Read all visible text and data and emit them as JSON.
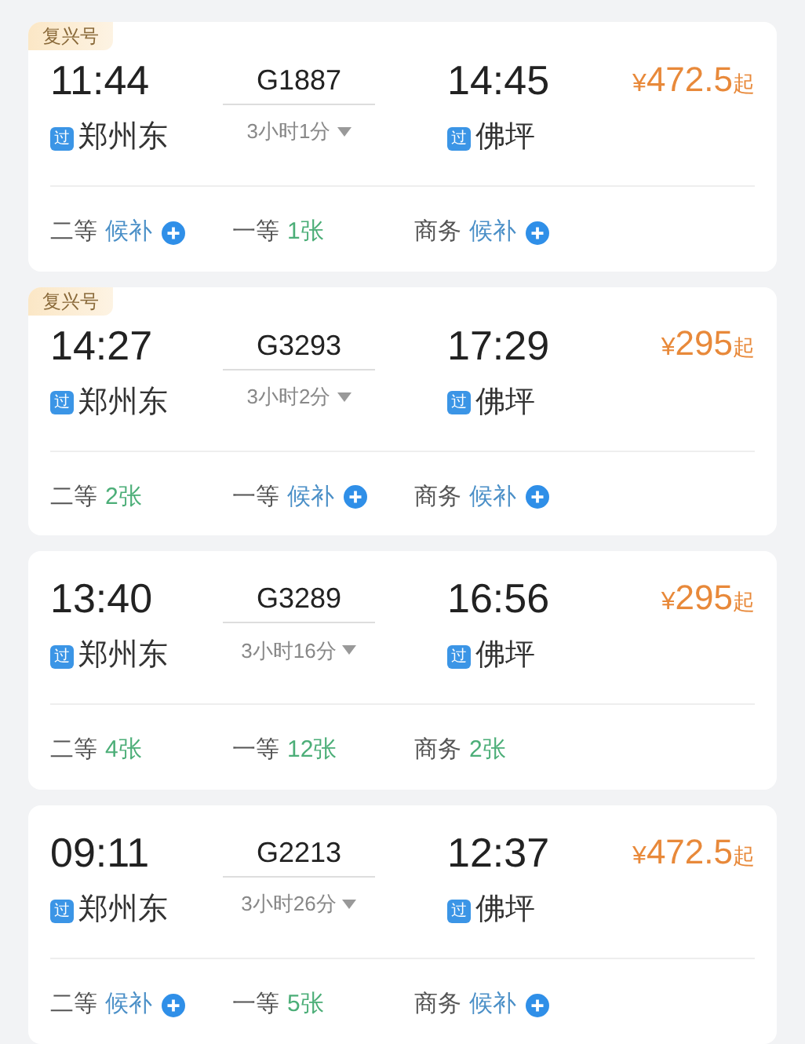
{
  "trains": [
    {
      "badge": "复兴号",
      "depart_time": "11:44",
      "train_number": "G1887",
      "arrive_time": "14:45",
      "price": {
        "symbol": "¥",
        "amount": "472.5",
        "suffix": "起"
      },
      "from": {
        "mark": "过",
        "name": "郑州东"
      },
      "duration": "3小时1分",
      "to": {
        "mark": "过",
        "name": "佛坪"
      },
      "seats": [
        {
          "class": "二等",
          "kind": "waitlist",
          "value": "候补"
        },
        {
          "class": "一等",
          "kind": "available",
          "value": "1张"
        },
        {
          "class": "商务",
          "kind": "waitlist",
          "value": "候补"
        }
      ]
    },
    {
      "badge": "复兴号",
      "depart_time": "14:27",
      "train_number": "G3293",
      "arrive_time": "17:29",
      "price": {
        "symbol": "¥",
        "amount": "295",
        "suffix": "起"
      },
      "from": {
        "mark": "过",
        "name": "郑州东"
      },
      "duration": "3小时2分",
      "to": {
        "mark": "过",
        "name": "佛坪"
      },
      "seats": [
        {
          "class": "二等",
          "kind": "available",
          "value": "2张"
        },
        {
          "class": "一等",
          "kind": "waitlist",
          "value": "候补"
        },
        {
          "class": "商务",
          "kind": "waitlist",
          "value": "候补"
        }
      ]
    },
    {
      "depart_time": "13:40",
      "train_number": "G3289",
      "arrive_time": "16:56",
      "price": {
        "symbol": "¥",
        "amount": "295",
        "suffix": "起"
      },
      "from": {
        "mark": "过",
        "name": "郑州东"
      },
      "duration": "3小时16分",
      "to": {
        "mark": "过",
        "name": "佛坪"
      },
      "seats": [
        {
          "class": "二等",
          "kind": "available",
          "value": "4张"
        },
        {
          "class": "一等",
          "kind": "available",
          "value": "12张"
        },
        {
          "class": "商务",
          "kind": "available",
          "value": "2张"
        }
      ]
    },
    {
      "depart_time": "09:11",
      "train_number": "G2213",
      "arrive_time": "12:37",
      "price": {
        "symbol": "¥",
        "amount": "472.5",
        "suffix": "起"
      },
      "from": {
        "mark": "过",
        "name": "郑州东"
      },
      "duration": "3小时26分",
      "to": {
        "mark": "过",
        "name": "佛坪"
      },
      "seats": [
        {
          "class": "二等",
          "kind": "waitlist",
          "value": "候补"
        },
        {
          "class": "一等",
          "kind": "available",
          "value": "5张"
        },
        {
          "class": "商务",
          "kind": "waitlist",
          "value": "候补"
        }
      ]
    }
  ]
}
